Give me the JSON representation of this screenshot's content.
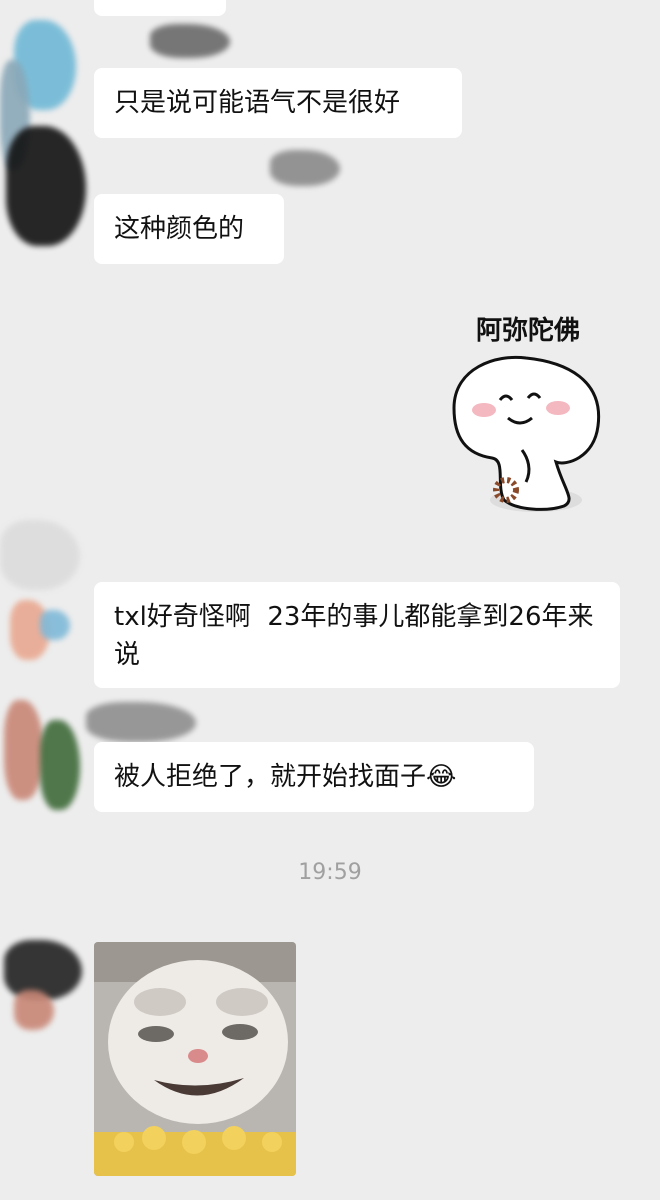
{
  "messages": [
    {
      "text": "只是说可能语气不是很好"
    },
    {
      "text": "这种颜色的"
    },
    {
      "sticker_text": "阿弥陀佛"
    },
    {
      "text": "txl好奇怪啊  23年的事儿都能拿到26年来说"
    },
    {
      "text": "被人拒绝了，就开始找面子😂"
    }
  ],
  "timestamp": "19:59",
  "colors": {
    "background": "#ededed",
    "bubble": "#ffffff",
    "timestamp_text": "#a0a0a0"
  }
}
